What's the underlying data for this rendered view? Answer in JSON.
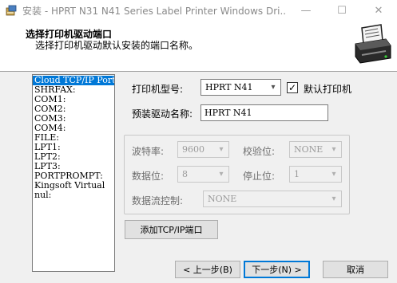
{
  "window": {
    "title": "安装 - HPRT N31 N41 Series Label Printer Windows Dri...",
    "minimize_glyph": "—",
    "maximize_glyph": "☐",
    "close_glyph": "✕"
  },
  "header": {
    "title": "选择打印机驱动端口",
    "subtitle": "选择打印机驱动默认安装的端口名称。"
  },
  "ports": {
    "items": [
      "Cloud TCP/IP Port",
      "SHRFAX:",
      "COM1:",
      "COM2:",
      "COM3:",
      "COM4:",
      "FILE:",
      "LPT1:",
      "LPT2:",
      "LPT3:",
      "PORTPROMPT:",
      "Kingsoft Virtual",
      "nul:"
    ],
    "selected_index": 0
  },
  "printer": {
    "model_label": "打印机型号:",
    "model_value": "HPRT N41",
    "default_checkbox_label": "默认打印机",
    "default_checked": true,
    "check_glyph": "✓",
    "driver_name_label": "预装驱动名称:",
    "driver_name_value": "HPRT N41"
  },
  "serial": {
    "baud_label": "波特率:",
    "baud_value": "9600",
    "parity_label": "校验位:",
    "parity_value": "NONE",
    "databits_label": "数据位:",
    "databits_value": "8",
    "stopbits_label": "停止位:",
    "stopbits_value": "1",
    "flow_label": "数据流控制:",
    "flow_value": "NONE"
  },
  "buttons": {
    "add_tcpip": "添加TCP/IP端口",
    "back": "< 上一步(B)",
    "next": "下一步(N) >",
    "cancel": "取消"
  },
  "icons": {
    "dropdown_arrow": "▾"
  },
  "colors": {
    "selection": "#0078d7",
    "default_button_border": "#0078d7"
  }
}
